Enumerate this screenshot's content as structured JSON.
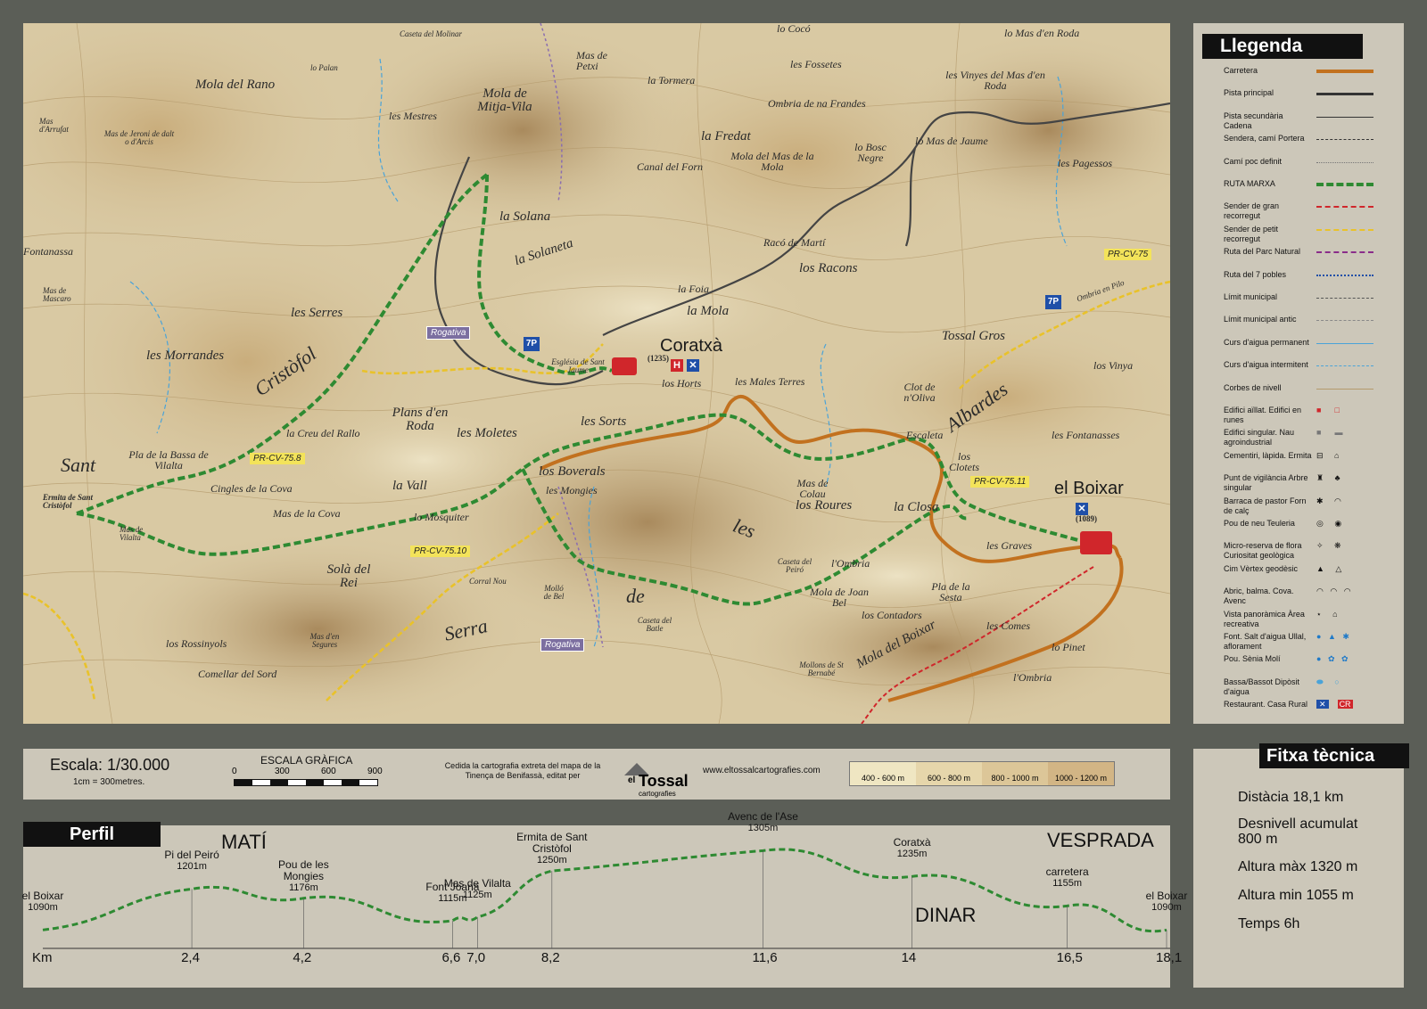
{
  "map": {
    "places": {
      "mola_rano": "Mola del Rano",
      "palan": "lo Palan",
      "casetadel_molinar": "Caseta del Molinar",
      "mola_mitja_vila": "Mola de Mitja-Vila",
      "petxi": "Mas de Petxi",
      "tormera": "la Tormera",
      "coco": "lo Cocó",
      "fossetes": "les Fossetes",
      "mas_roda": "lo Mas d'en Roda",
      "vinyes": "les Vinyes del Mas d'en Roda",
      "ombria_frandes": "Ombria de na Frandes",
      "mestres": "les Mestres",
      "fredat": "la Fredat",
      "mola_mas_mola": "Mola del Mas de la Mola",
      "bosc_negre": "lo Bosc Negre",
      "mas_jaume": "lo Mas de Jaume",
      "pagessos": "les Pagessos",
      "mas_arrufat": "Mas d'Arrufat",
      "jeroni": "Mas de Jeroni de dalt o d'Arcis",
      "canal_forn": "Canal del Forn",
      "solana": "la Solana",
      "solaneta": "la Solaneta",
      "fontanassa": "Fontanassa",
      "mascaro": "Mas de Mascaro",
      "serres": "les Serres",
      "racons": "los Racons",
      "raco_marti": "Racó de Martí",
      "foia": "la Foia",
      "mola": "la Mola",
      "morrandes": "les Morrandes",
      "cristofol": "Cristòfol",
      "coratxa": "Coratxà",
      "tossal_gros": "Tossal Gros",
      "horts": "los Horts",
      "males_terres": "les Males Terres",
      "clot_oliva": "Clot de n'Oliva",
      "albardes": "Albardes",
      "plans_roda": "Plans d'en Roda",
      "sorts": "les Sorts",
      "moletes": "les Moletes",
      "creu_rallo": "la Creu del Rallo",
      "escaleta": "Escaleta",
      "fontanasses": "les Fontanasses",
      "sant": "Sant",
      "pla_bassa": "Pla de la Bassa de Vilalta",
      "boverals": "los Boverals",
      "vall": "la Vall",
      "mongies": "les Mongies",
      "clotets": "los Clotets",
      "boixar": "el Boixar",
      "cingles_cova": "Cingles de la Cova",
      "mas_cova": "Mas de la Cova",
      "mas_colau": "Mas de Colau",
      "roures": "los Roures",
      "closa": "la Closa",
      "mosquiter": "lo Mosquiter",
      "mas_vilalta": "Mas de Vilalta",
      "les": "les",
      "sola_rei": "Solà del Rei",
      "ombria": "l'Ombria",
      "graves": "les Graves",
      "de": "de",
      "serra": "Serra",
      "pla_sesta": "Pla de la Sesta",
      "mola_joan_bel": "Mola de Joan Bel",
      "contadors": "los Contadors",
      "mola_boixar": "Mola del Boixar",
      "comes": "les Comes",
      "pinet": "lo Pinet",
      "rossinyols": "los Rossinyols",
      "comellar_sord": "Comellar del Sord",
      "mas_segures": "Mas d'en Segures",
      "mollons": "Mollons de St Bernabé",
      "lombria": "l'Ombria",
      "vinya": "los Vinya",
      "ombria_pilo": "Ombria en Pilo",
      "ermita": "Ermita de Sant Cristòfol",
      "esglesia": "Església de Sant Jaume",
      "caseta_batle": "Caseta del Batle",
      "mollo_bel": "Molló de Bel",
      "corral_nou": "Corral Nou",
      "caseta_peiro": "Caseta del Peiró"
    },
    "elevations": {
      "coratxa": "(1235)",
      "boixar": "(1089)"
    },
    "tags": {
      "pr_75": "PR-CV-75",
      "pr_758": "PR-CV-75.8",
      "pr_7510": "PR-CV-75.10",
      "pr_7511": "PR-CV-75.11",
      "rogativa1": "Rogativa",
      "rogativa2": "Rogativa"
    }
  },
  "legend": {
    "title": "Llegenda",
    "items": [
      {
        "label": "Carretera",
        "symbol": "road-orange"
      },
      {
        "label": "Pista principal",
        "symbol": "track-dark"
      },
      {
        "label": "Pista secundària Cadena",
        "symbol": "track-secondary"
      },
      {
        "label": "Sendera, camí Portera",
        "symbol": "path-dashed"
      },
      {
        "label": "Camí poc definit",
        "symbol": "path-dotted"
      },
      {
        "label": "RUTA MARXA",
        "symbol": "route-green"
      },
      {
        "label": "Sender de gran recorregut",
        "symbol": "gr-red"
      },
      {
        "label": "Sender de petit recorregut",
        "symbol": "pr-yellow"
      },
      {
        "label": "Ruta del Parc Natural",
        "symbol": "park-purple"
      },
      {
        "label": "Ruta del 7 pobles",
        "symbol": "blue-dotted"
      },
      {
        "label": "Límit municipal",
        "symbol": "limit"
      },
      {
        "label": "Límit municipal antic",
        "symbol": "limit-old"
      },
      {
        "label": "Curs d'aigua permanent",
        "symbol": "water-perm"
      },
      {
        "label": "Curs d'aigua intermitent",
        "symbol": "water-int"
      },
      {
        "label": "Corbes de nivell",
        "symbol": "contour"
      },
      {
        "label": "Edifici aïllat. Edifici en runes",
        "symbol": "building"
      },
      {
        "label": "Edifici singular. Nau agroindustrial",
        "symbol": "building-singular"
      },
      {
        "label": "Cementiri, làpida. Ermita",
        "symbol": "cemetery"
      },
      {
        "label": "Punt de vigilància Arbre singular",
        "symbol": "watch"
      },
      {
        "label": "Barraca de pastor Forn de calç",
        "symbol": "hut"
      },
      {
        "label": "Pou de neu Teuleria",
        "symbol": "snow-well"
      },
      {
        "label": "Micro-reserva de flora Curiositat geològica",
        "symbol": "reserve"
      },
      {
        "label": "Cim Vèrtex geodèsic",
        "symbol": "peak"
      },
      {
        "label": "Abric, balma. Cova. Avenc",
        "symbol": "cave"
      },
      {
        "label": "Vista panoràmica Àrea recreativa",
        "symbol": "view"
      },
      {
        "label": "Font. Salt d'aigua Ullal, aflorament",
        "symbol": "spring"
      },
      {
        "label": "Pou. Sènia Molí",
        "symbol": "well"
      },
      {
        "label": "Bassa/Bassot Dipòsit d'aigua",
        "symbol": "pond"
      },
      {
        "label": "Restaurant. Casa Rural",
        "symbol": "restaurant"
      }
    ]
  },
  "scale": {
    "escala": "Escala: 1/30.000",
    "cm": "1cm = 300metres.",
    "grafica": "ESCALA GRÀFICA",
    "ticks": [
      "0",
      "300",
      "600",
      "900"
    ],
    "credit": "Cedida la cartografia extreta del mapa de la Tinença de Benifassà, editat per",
    "logo_el": "el",
    "logo_tossal": "Tossal",
    "logo_sub": "cartografies",
    "url": "www.eltossalcartografies.com",
    "bands": [
      "400 - 600 m",
      "600 - 800 m",
      "800 - 1000 m",
      "1000 - 1200 m"
    ],
    "band_colors": [
      "#efe6c2",
      "#e6d6ab",
      "#dcc698",
      "#d2b585"
    ]
  },
  "profile": {
    "title": "Perfil",
    "mati": "MATÍ",
    "vesprada": "VESPRADA",
    "dinar": "DINAR",
    "km_label": "Km",
    "route_color": "#2e8a32",
    "km_marks": [
      "2,4",
      "4,2",
      "6,6",
      "7,0",
      "8,2",
      "11,6",
      "14",
      "16,5",
      "18,1"
    ],
    "points": [
      {
        "name": "el Boixar",
        "elev": "1090m"
      },
      {
        "name": "Pi del Peiró",
        "elev": "1201m"
      },
      {
        "name": "Pou de les Mongies",
        "elev": "1176m"
      },
      {
        "name": "Font Joana",
        "elev": "1115m"
      },
      {
        "name": "Mas de Vilalta",
        "elev": "1125m"
      },
      {
        "name": "Ermita de Sant Cristòfol",
        "elev": "1250m"
      },
      {
        "name": "Avenc de l'Ase",
        "elev": "1305m"
      },
      {
        "name": "Coratxà",
        "elev": "1235m"
      },
      {
        "name": "carretera",
        "elev": "1155m"
      },
      {
        "name": "el Boixar",
        "elev": "1090m"
      }
    ]
  },
  "fitxa": {
    "title": "Fitxa tècnica",
    "distancia": "Distàcia 18,1 km",
    "desnivell": "Desnivell acumulat 800 m",
    "max": "Altura màx 1320 m",
    "min": "Altura min 1055 m",
    "temps": "Temps 6h"
  }
}
